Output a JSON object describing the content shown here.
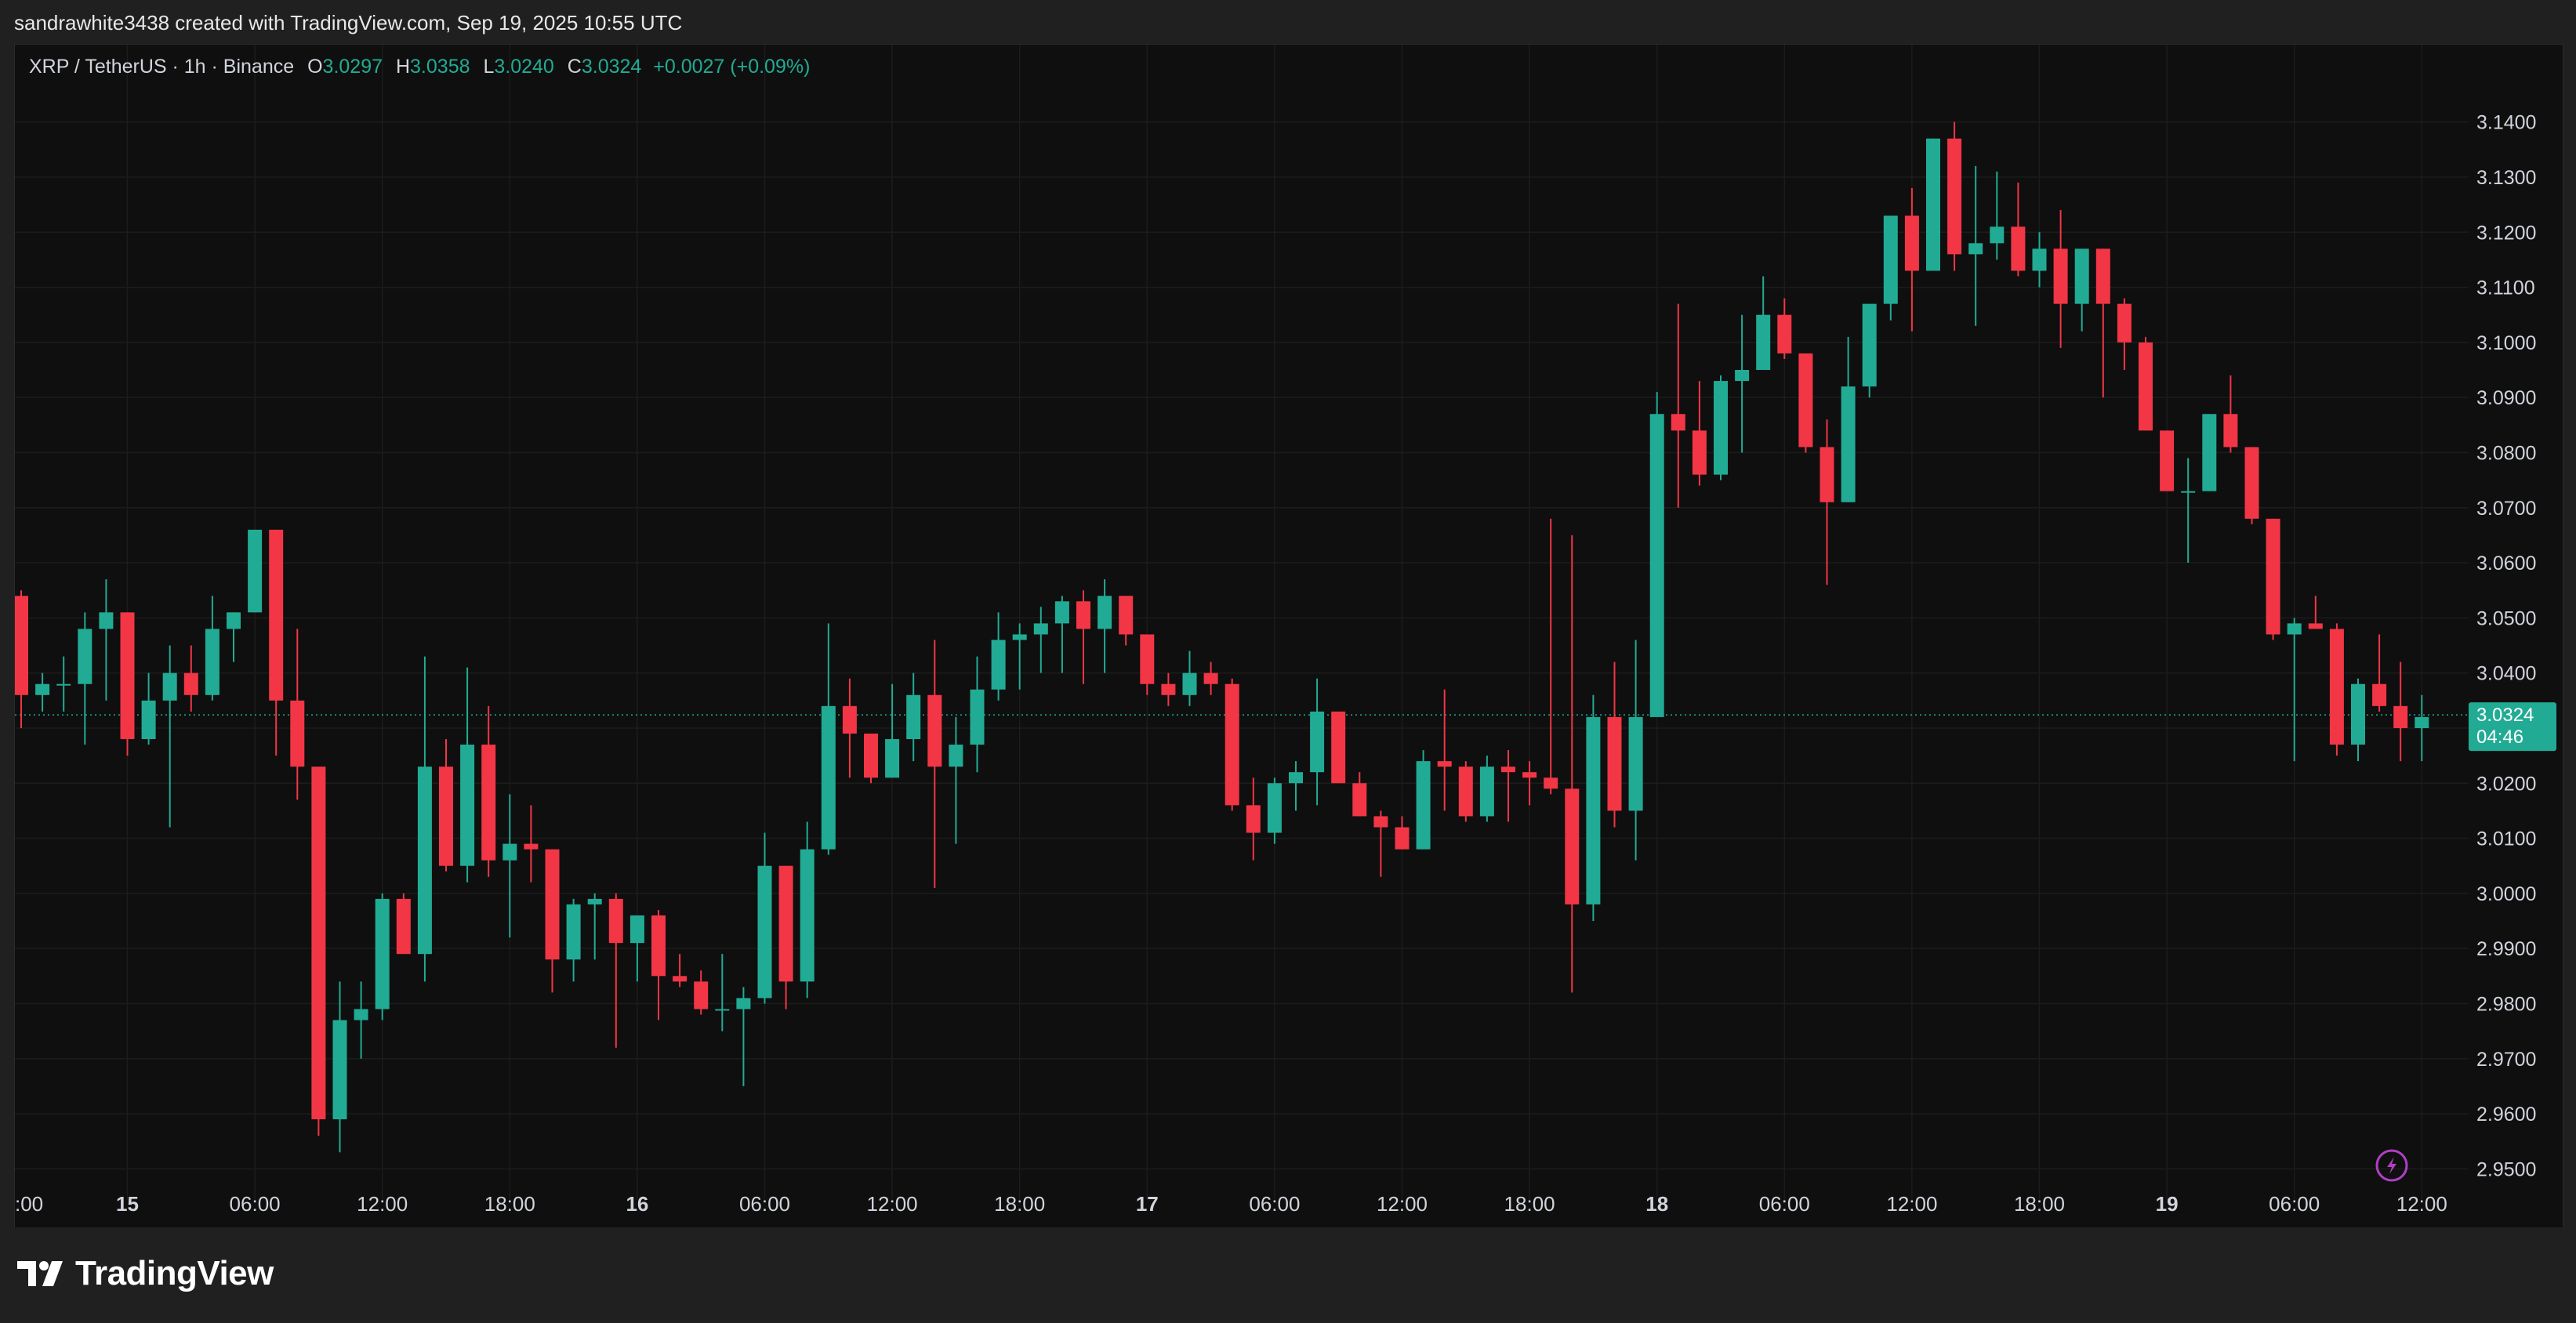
{
  "header": {
    "attribution": "sandrawhite3438 created with TradingView.com, Sep 19, 2025 10:55 UTC"
  },
  "legend": {
    "symbol": "XRP / TetherUS · 1h · Binance",
    "open_label": "O",
    "open": "3.0297",
    "high_label": "H",
    "high": "3.0358",
    "low_label": "L",
    "low": "3.0240",
    "close_label": "C",
    "close": "3.0324",
    "change": "+0.0027 (+0.09%)"
  },
  "price_badge": {
    "price": "3.0324",
    "countdown": "04:46"
  },
  "footer": {
    "brand": "TradingView"
  },
  "colors": {
    "up": "#22ab94",
    "down": "#f23645",
    "background": "#0f0f0f",
    "grid": "#1c1c1c",
    "text": "#d1d4dc"
  },
  "chart_data": {
    "type": "candlestick",
    "interval": "1h",
    "ylim": [
      2.9418,
      3.1455
    ],
    "y_ticks": [
      3.14,
      3.13,
      3.12,
      3.11,
      3.1,
      3.09,
      3.08,
      3.07,
      3.06,
      3.05,
      3.04,
      3.03,
      3.02,
      3.01,
      3.0,
      2.99,
      2.98,
      2.97,
      2.96,
      2.95
    ],
    "y_tick_labels": [
      "3.1400",
      "3.1300",
      "3.1200",
      "3.1100",
      "3.1000",
      "3.0900",
      "3.0800",
      "3.0700",
      "3.0600",
      "3.0500",
      "3.0400",
      "3.0300",
      "3.0200",
      "3.0100",
      "3.0000",
      "2.9900",
      "2.9800",
      "2.9700",
      "2.9600",
      "2.9500"
    ],
    "x_ticks": [
      {
        "label": ":00",
        "bar": -1
      },
      {
        "label": "15",
        "bar": 5,
        "bold": true
      },
      {
        "label": "06:00",
        "bar": 11
      },
      {
        "label": "12:00",
        "bar": 17
      },
      {
        "label": "18:00",
        "bar": 23
      },
      {
        "label": "16",
        "bar": 29,
        "bold": true
      },
      {
        "label": "06:00",
        "bar": 35
      },
      {
        "label": "12:00",
        "bar": 41
      },
      {
        "label": "18:00",
        "bar": 47
      },
      {
        "label": "17",
        "bar": 53,
        "bold": true
      },
      {
        "label": "06:00",
        "bar": 59
      },
      {
        "label": "12:00",
        "bar": 65
      },
      {
        "label": "18:00",
        "bar": 71
      },
      {
        "label": "18",
        "bar": 77,
        "bold": true
      },
      {
        "label": "06:00",
        "bar": 83
      },
      {
        "label": "12:00",
        "bar": 89
      },
      {
        "label": "18:00",
        "bar": 95
      },
      {
        "label": "19",
        "bar": 101,
        "bold": true
      },
      {
        "label": "06:00",
        "bar": 107
      },
      {
        "label": "12:00",
        "bar": 113
      }
    ],
    "last_price": 3.0324,
    "ohlc": [
      [
        3.054,
        3.055,
        3.03,
        3.036
      ],
      [
        3.036,
        3.04,
        3.033,
        3.038
      ],
      [
        3.038,
        3.043,
        3.033,
        3.038
      ],
      [
        3.038,
        3.051,
        3.027,
        3.048
      ],
      [
        3.048,
        3.057,
        3.035,
        3.051
      ],
      [
        3.051,
        3.051,
        3.025,
        3.028
      ],
      [
        3.028,
        3.04,
        3.027,
        3.035
      ],
      [
        3.035,
        3.045,
        3.012,
        3.04
      ],
      [
        3.04,
        3.045,
        3.033,
        3.036
      ],
      [
        3.036,
        3.054,
        3.035,
        3.048
      ],
      [
        3.048,
        3.051,
        3.042,
        3.051
      ],
      [
        3.051,
        3.066,
        3.051,
        3.066
      ],
      [
        3.066,
        3.066,
        3.025,
        3.035
      ],
      [
        3.035,
        3.048,
        3.017,
        3.023
      ],
      [
        3.023,
        3.023,
        2.956,
        2.959
      ],
      [
        2.959,
        2.984,
        2.953,
        2.977
      ],
      [
        2.977,
        2.984,
        2.97,
        2.979
      ],
      [
        2.979,
        3.0,
        2.977,
        2.999
      ],
      [
        2.999,
        3.0,
        2.989,
        2.989
      ],
      [
        2.989,
        3.043,
        2.984,
        3.023
      ],
      [
        3.023,
        3.028,
        3.004,
        3.005
      ],
      [
        3.005,
        3.041,
        3.002,
        3.027
      ],
      [
        3.027,
        3.034,
        3.003,
        3.006
      ],
      [
        3.006,
        3.018,
        2.992,
        3.009
      ],
      [
        3.009,
        3.016,
        3.002,
        3.008
      ],
      [
        3.008,
        3.008,
        2.982,
        2.988
      ],
      [
        2.988,
        2.999,
        2.984,
        2.998
      ],
      [
        2.998,
        3.0,
        2.988,
        2.999
      ],
      [
        2.999,
        3.0,
        2.972,
        2.991
      ],
      [
        2.991,
        2.996,
        2.984,
        2.996
      ],
      [
        2.996,
        2.997,
        2.977,
        2.985
      ],
      [
        2.985,
        2.989,
        2.983,
        2.984
      ],
      [
        2.984,
        2.986,
        2.978,
        2.979
      ],
      [
        2.979,
        2.989,
        2.975,
        2.979
      ],
      [
        2.979,
        2.983,
        2.965,
        2.981
      ],
      [
        2.981,
        3.011,
        2.98,
        3.005
      ],
      [
        3.005,
        3.005,
        2.979,
        2.984
      ],
      [
        2.984,
        3.013,
        2.981,
        3.008
      ],
      [
        3.008,
        3.049,
        3.007,
        3.034
      ],
      [
        3.034,
        3.039,
        3.021,
        3.029
      ],
      [
        3.029,
        3.029,
        3.02,
        3.021
      ],
      [
        3.021,
        3.038,
        3.021,
        3.028
      ],
      [
        3.028,
        3.04,
        3.024,
        3.036
      ],
      [
        3.036,
        3.046,
        3.001,
        3.023
      ],
      [
        3.023,
        3.032,
        3.009,
        3.027
      ],
      [
        3.027,
        3.043,
        3.022,
        3.037
      ],
      [
        3.037,
        3.051,
        3.035,
        3.046
      ],
      [
        3.046,
        3.049,
        3.037,
        3.047
      ],
      [
        3.047,
        3.052,
        3.04,
        3.049
      ],
      [
        3.049,
        3.054,
        3.04,
        3.053
      ],
      [
        3.053,
        3.055,
        3.038,
        3.048
      ],
      [
        3.048,
        3.057,
        3.04,
        3.054
      ],
      [
        3.054,
        3.054,
        3.045,
        3.047
      ],
      [
        3.047,
        3.047,
        3.036,
        3.038
      ],
      [
        3.038,
        3.04,
        3.034,
        3.036
      ],
      [
        3.036,
        3.044,
        3.034,
        3.04
      ],
      [
        3.04,
        3.042,
        3.036,
        3.038
      ],
      [
        3.038,
        3.039,
        3.015,
        3.016
      ],
      [
        3.016,
        3.021,
        3.006,
        3.011
      ],
      [
        3.011,
        3.021,
        3.009,
        3.02
      ],
      [
        3.02,
        3.024,
        3.015,
        3.022
      ],
      [
        3.022,
        3.039,
        3.016,
        3.033
      ],
      [
        3.033,
        3.033,
        3.02,
        3.02
      ],
      [
        3.02,
        3.022,
        3.014,
        3.014
      ],
      [
        3.014,
        3.015,
        3.003,
        3.012
      ],
      [
        3.012,
        3.014,
        3.008,
        3.008
      ],
      [
        3.008,
        3.026,
        3.008,
        3.024
      ],
      [
        3.024,
        3.037,
        3.015,
        3.023
      ],
      [
        3.023,
        3.024,
        3.013,
        3.014
      ],
      [
        3.014,
        3.025,
        3.013,
        3.023
      ],
      [
        3.023,
        3.026,
        3.013,
        3.022
      ],
      [
        3.022,
        3.024,
        3.016,
        3.021
      ],
      [
        3.021,
        3.068,
        3.018,
        3.019
      ],
      [
        3.019,
        3.065,
        2.982,
        2.998
      ],
      [
        2.998,
        3.036,
        2.995,
        3.032
      ],
      [
        3.032,
        3.042,
        3.012,
        3.015
      ],
      [
        3.015,
        3.046,
        3.006,
        3.032
      ],
      [
        3.032,
        3.091,
        3.032,
        3.087
      ],
      [
        3.087,
        3.107,
        3.07,
        3.084
      ],
      [
        3.084,
        3.093,
        3.074,
        3.076
      ],
      [
        3.076,
        3.094,
        3.075,
        3.093
      ],
      [
        3.093,
        3.105,
        3.08,
        3.095
      ],
      [
        3.095,
        3.112,
        3.095,
        3.105
      ],
      [
        3.105,
        3.108,
        3.097,
        3.098
      ],
      [
        3.098,
        3.098,
        3.08,
        3.081
      ],
      [
        3.081,
        3.086,
        3.056,
        3.071
      ],
      [
        3.071,
        3.101,
        3.071,
        3.092
      ],
      [
        3.092,
        3.107,
        3.09,
        3.107
      ],
      [
        3.107,
        3.123,
        3.104,
        3.123
      ],
      [
        3.123,
        3.128,
        3.102,
        3.113
      ],
      [
        3.113,
        3.137,
        3.113,
        3.137
      ],
      [
        3.137,
        3.14,
        3.113,
        3.116
      ],
      [
        3.116,
        3.132,
        3.103,
        3.118
      ],
      [
        3.118,
        3.131,
        3.115,
        3.121
      ],
      [
        3.121,
        3.129,
        3.112,
        3.113
      ],
      [
        3.113,
        3.12,
        3.11,
        3.117
      ],
      [
        3.117,
        3.124,
        3.099,
        3.107
      ],
      [
        3.107,
        3.117,
        3.102,
        3.117
      ],
      [
        3.117,
        3.117,
        3.09,
        3.107
      ],
      [
        3.107,
        3.108,
        3.095,
        3.1
      ],
      [
        3.1,
        3.101,
        3.084,
        3.084
      ],
      [
        3.084,
        3.084,
        3.073,
        3.073
      ],
      [
        3.073,
        3.079,
        3.06,
        3.073
      ],
      [
        3.073,
        3.087,
        3.073,
        3.087
      ],
      [
        3.087,
        3.094,
        3.08,
        3.081
      ],
      [
        3.081,
        3.081,
        3.067,
        3.068
      ],
      [
        3.068,
        3.068,
        3.046,
        3.047
      ],
      [
        3.047,
        3.05,
        3.024,
        3.049
      ],
      [
        3.049,
        3.054,
        3.049,
        3.048
      ],
      [
        3.048,
        3.049,
        3.025,
        3.027
      ],
      [
        3.027,
        3.039,
        3.024,
        3.038
      ],
      [
        3.038,
        3.047,
        3.033,
        3.034
      ],
      [
        3.034,
        3.042,
        3.024,
        3.03
      ],
      [
        3.03,
        3.036,
        3.024,
        3.032
      ]
    ]
  }
}
